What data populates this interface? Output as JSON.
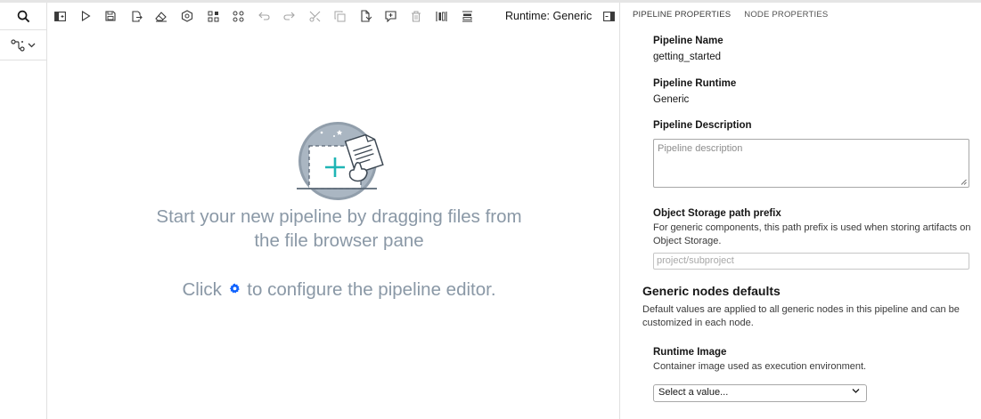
{
  "toolbar": {
    "runtime_label": "Runtime: Generic",
    "buttons": [
      "open-panel",
      "run-pipeline",
      "save-pipeline",
      "export-pipeline",
      "clear-pipeline",
      "open-runtimes",
      "open-runtime-images",
      "open-component-catalogs",
      "undo",
      "redo",
      "cut",
      "copy",
      "paste",
      "add-comment",
      "delete",
      "arrange-horizontal",
      "arrange-vertical"
    ]
  },
  "canvas": {
    "empty_message": "Start your new pipeline by dragging files from the file browser pane",
    "config_prefix": "Click",
    "config_suffix": "to configure the pipeline editor."
  },
  "properties": {
    "tabs": [
      "PIPELINE PROPERTIES",
      "NODE PROPERTIES"
    ],
    "pipeline_name_label": "Pipeline Name",
    "pipeline_name_value": "getting_started",
    "pipeline_runtime_label": "Pipeline Runtime",
    "pipeline_runtime_value": "Generic",
    "pipeline_description_label": "Pipeline Description",
    "pipeline_description_placeholder": "Pipeline description",
    "object_storage_label": "Object Storage path prefix",
    "object_storage_helper": "For generic components, this path prefix is used when storing artifacts on Object Storage.",
    "object_storage_placeholder": "project/subproject",
    "generic_defaults_title": "Generic nodes defaults",
    "generic_defaults_helper": "Default values are applied to all generic nodes in this pipeline and can be customized in each node.",
    "runtime_image_label": "Runtime Image",
    "runtime_image_helper": "Container image used as execution environment.",
    "runtime_image_select": "Select a value..."
  },
  "colors": {
    "accent": "#0f62fe",
    "empty_text": "#8a98a6",
    "illustration_plus": "#1fb5b5"
  }
}
